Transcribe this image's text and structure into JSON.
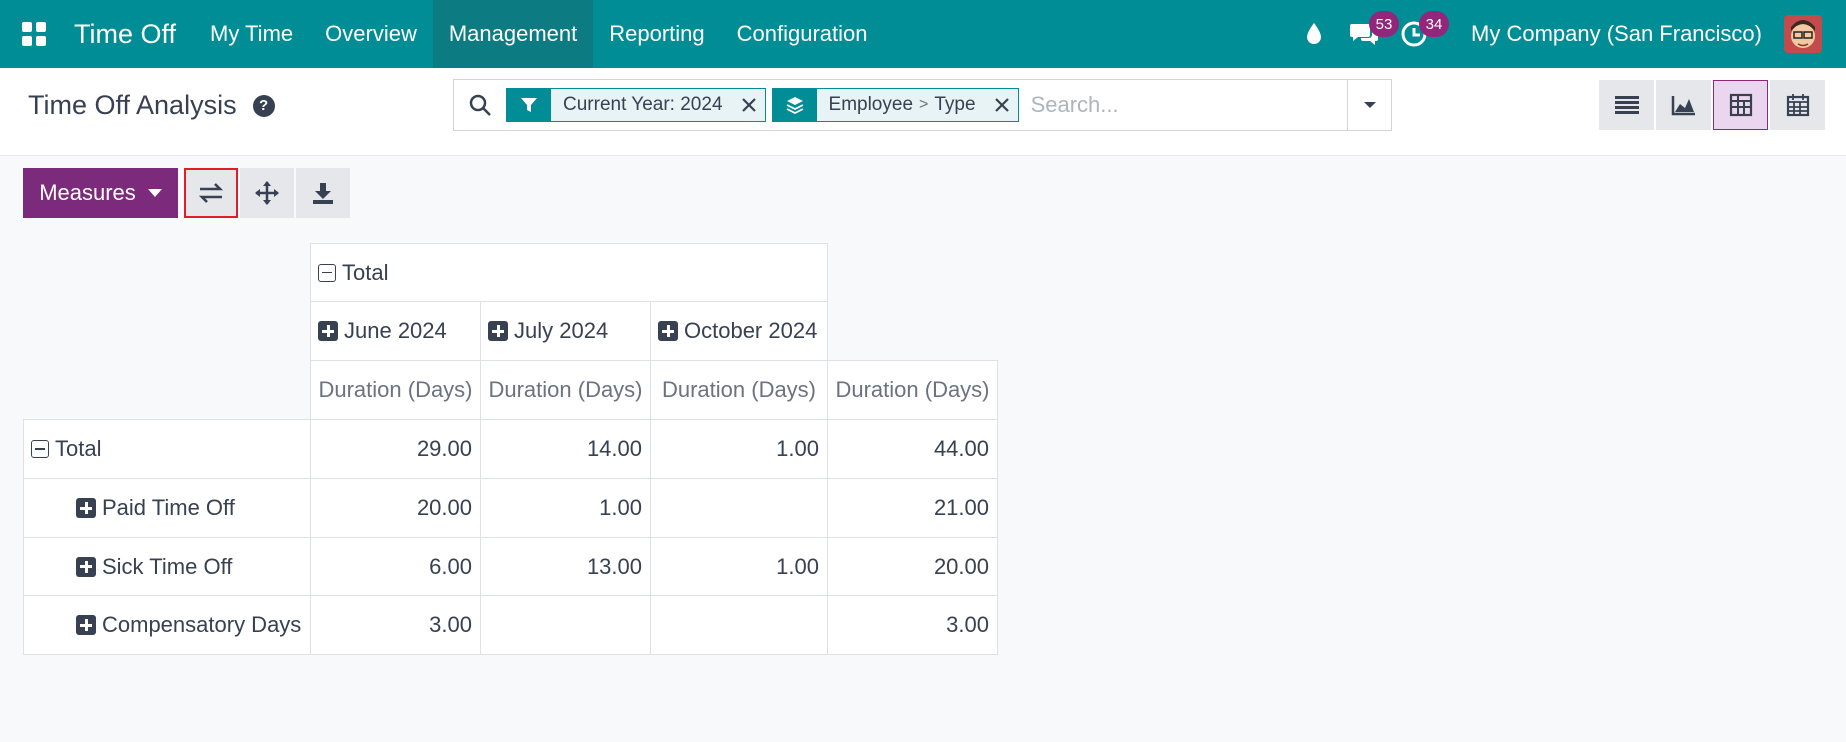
{
  "navbar": {
    "app_title": "Time Off",
    "menu": [
      "My Time",
      "Overview",
      "Management",
      "Reporting",
      "Configuration"
    ],
    "active_menu": "Management",
    "messages_count": "53",
    "activities_count": "34",
    "company": "My Company (San Francisco)",
    "color": "#018d95"
  },
  "control_panel": {
    "title": "Time Off Analysis",
    "help": "?",
    "facets": [
      {
        "icon": "filter-icon",
        "label": "Current Year: 2024"
      },
      {
        "icon": "layers-icon",
        "group_by": [
          "Employee",
          "Type"
        ]
      }
    ],
    "group_sep": ">",
    "search_placeholder": "Search..."
  },
  "toolbar": {
    "measures_label": "Measures"
  },
  "pivot": {
    "col_total_label": "Total",
    "col_groups": [
      "June 2024",
      "July 2024",
      "October 2024"
    ],
    "measure_label": "Duration (Days)",
    "row_total_label": "Total",
    "rows": [
      {
        "label": "Total",
        "values": [
          "29.00",
          "14.00",
          "1.00",
          "44.00"
        ]
      },
      {
        "label": "Paid Time Off",
        "values": [
          "20.00",
          "1.00",
          "",
          "21.00"
        ]
      },
      {
        "label": "Sick Time Off",
        "values": [
          "6.00",
          "13.00",
          "1.00",
          "20.00"
        ]
      },
      {
        "label": "Compensatory Days",
        "values": [
          "3.00",
          "",
          "",
          "3.00"
        ]
      }
    ]
  }
}
